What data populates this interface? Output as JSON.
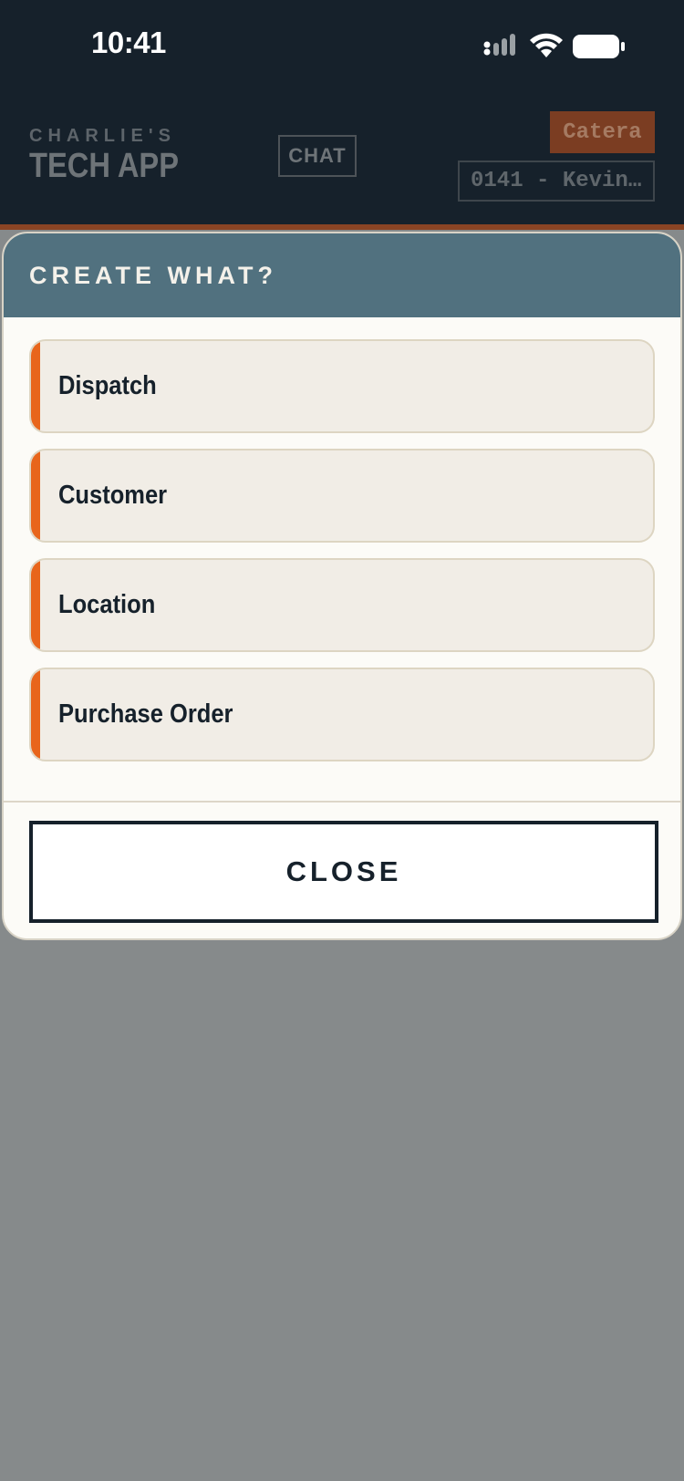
{
  "status_bar": {
    "time": "10:41",
    "icons": [
      "signal-icon",
      "wifi-icon",
      "battery-icon"
    ]
  },
  "header": {
    "brand_top": "CHARLIE'S",
    "brand_main": "TECH APP",
    "chat_label": "CHAT",
    "company_badge": "Catera",
    "technician": "0141 - Kevin…"
  },
  "modal": {
    "title": "CREATE WHAT?",
    "options": [
      {
        "label": "Dispatch"
      },
      {
        "label": "Customer"
      },
      {
        "label": "Location"
      },
      {
        "label": "Purchase Order"
      }
    ],
    "close_label": "CLOSE"
  },
  "colors": {
    "header_bg": "#16212b",
    "accent": "#e8651b",
    "modal_header_bg": "#51717f",
    "overlay": "#868a8b",
    "option_bg": "#f1ede6"
  }
}
